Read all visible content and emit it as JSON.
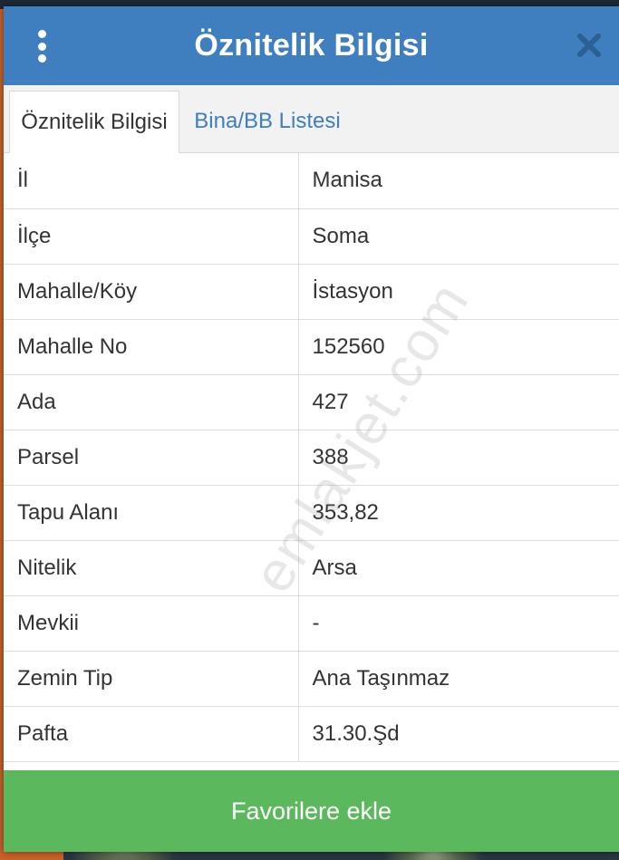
{
  "header": {
    "title": "Öznitelik Bilgisi"
  },
  "tabs": [
    {
      "label": "Öznitelik Bilgisi",
      "active": true
    },
    {
      "label": "Bina/BB Listesi",
      "active": false
    }
  ],
  "attributes": [
    {
      "key": "İl",
      "value": "Manisa"
    },
    {
      "key": "İlçe",
      "value": "Soma"
    },
    {
      "key": "Mahalle/Köy",
      "value": "İstasyon"
    },
    {
      "key": "Mahalle No",
      "value": "152560"
    },
    {
      "key": "Ada",
      "value": "427"
    },
    {
      "key": "Parsel",
      "value": "388"
    },
    {
      "key": "Tapu Alanı",
      "value": "353,82"
    },
    {
      "key": "Nitelik",
      "value": "Arsa"
    },
    {
      "key": "Mevkii",
      "value": "-"
    },
    {
      "key": "Zemin Tip",
      "value": "Ana Taşınmaz"
    },
    {
      "key": "Pafta",
      "value": "31.30.Şd"
    }
  ],
  "watermark": "emlakjet.com",
  "favorite_button": {
    "label": "Favorilere ekle"
  },
  "colors": {
    "header": "#3f7fbf",
    "tab_link": "#3f7fbf",
    "button": "#5cb85c"
  },
  "icons": {
    "menu": "vertical-ellipsis",
    "close": "x-mark"
  }
}
